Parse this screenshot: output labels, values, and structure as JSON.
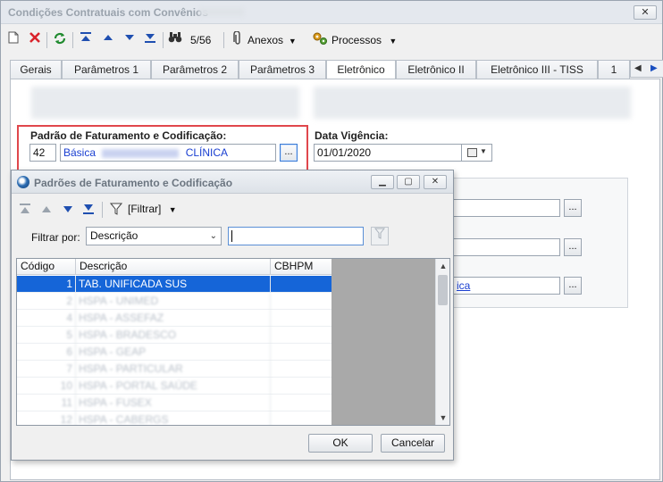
{
  "window": {
    "title": "Condições Contratuais com Convênios",
    "close_label": "✕"
  },
  "toolbar": {
    "record_counter": "5/56",
    "anexos_label": "Anexos",
    "processos_label": "Processos"
  },
  "tabs": [
    {
      "label": "Gerais"
    },
    {
      "label": "Parâmetros 1"
    },
    {
      "label": "Parâmetros 2"
    },
    {
      "label": "Parâmetros 3"
    },
    {
      "label": "Eletrônico"
    },
    {
      "label": "Eletrônico II"
    },
    {
      "label": "Eletrônico III - TISS"
    },
    {
      "label": "1"
    }
  ],
  "active_tab": "Eletrônico",
  "form": {
    "padrao_label": "Padrão de Faturamento e Codificação:",
    "padrao_code": "42",
    "padrao_name_prefix": "Básica",
    "padrao_name_suffix": "CLÍNICA",
    "dots_label": "...",
    "vigencia_label": "Data Vigência:",
    "vigencia_value": "01/01/2020",
    "right_link_3": "ica"
  },
  "dialog": {
    "title": "Padrões de Faturamento e Codificação",
    "filter_button_label": "[Filtrar]",
    "filter_by_label": "Filtrar por:",
    "filter_by_value": "Descrição",
    "filter_text": "",
    "columns": [
      "Código",
      "Descrição",
      "CBHPM"
    ],
    "rows": [
      {
        "code": "1",
        "desc": "TAB. UNIFICADA SUS",
        "cbhpm": ""
      },
      {
        "code": "2",
        "desc": "HSPA - UNIMED",
        "cbhpm": ""
      },
      {
        "code": "4",
        "desc": "HSPA - ASSEFAZ",
        "cbhpm": ""
      },
      {
        "code": "5",
        "desc": "HSPA - BRADESCO",
        "cbhpm": ""
      },
      {
        "code": "6",
        "desc": "HSPA - GEAP",
        "cbhpm": ""
      },
      {
        "code": "7",
        "desc": "HSPA - PARTICULAR",
        "cbhpm": ""
      },
      {
        "code": "10",
        "desc": "HSPA - PORTAL SAÚDE",
        "cbhpm": ""
      },
      {
        "code": "11",
        "desc": "HSPA - FUSEX",
        "cbhpm": ""
      },
      {
        "code": "12",
        "desc": "HSPA - CABERGS",
        "cbhpm": ""
      }
    ],
    "ok_label": "OK",
    "cancel_label": "Cancelar"
  },
  "colors": {
    "selection": "#1565d8",
    "highlight_border": "#e0474c",
    "link": "#1a3fd1"
  }
}
